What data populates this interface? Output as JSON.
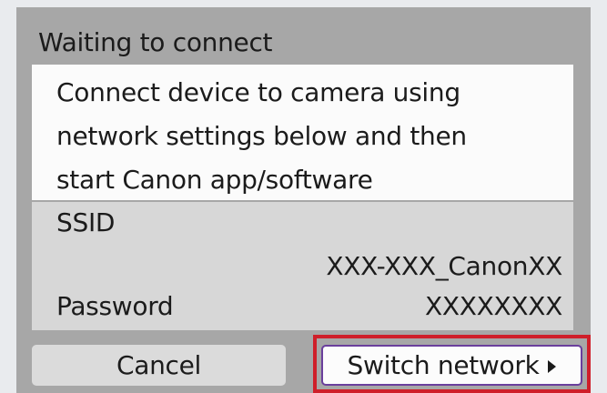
{
  "dialog": {
    "title": "Waiting to connect",
    "message_lines": [
      "Connect device to camera using",
      "network settings below and then",
      "start Canon app/software"
    ]
  },
  "network": {
    "ssid_label": "SSID",
    "ssid_value": "XXX-XXX_CanonXX",
    "password_label": "Password",
    "password_value": "XXXXXXXX"
  },
  "buttons": {
    "cancel_label": "Cancel",
    "switch_label": "Switch network"
  },
  "colors": {
    "highlight": "#cf1f2a",
    "focus_border": "#6a3f9c"
  },
  "icons": {
    "switch_arrow": "caret-right-icon"
  }
}
